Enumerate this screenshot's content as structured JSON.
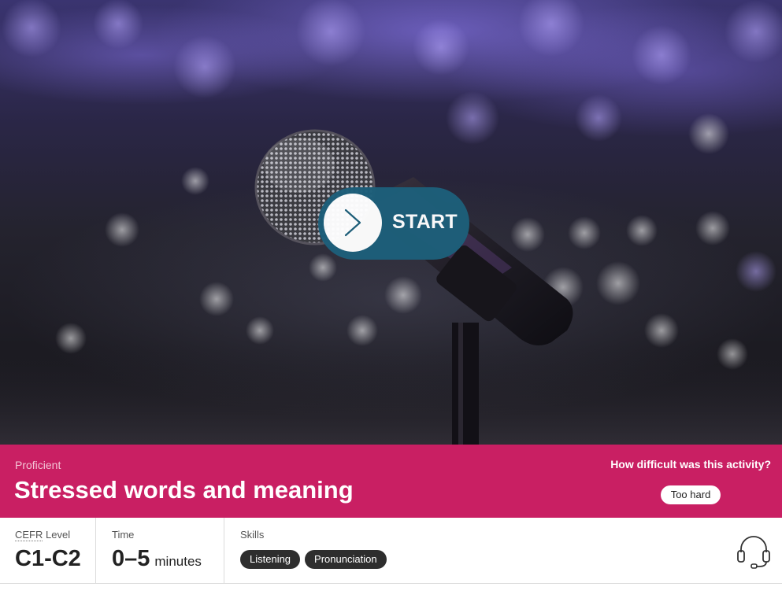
{
  "hero": {
    "start_label": "START",
    "icons": {
      "start": "chevron-right-icon",
      "microphone": "microphone-icon"
    }
  },
  "band": {
    "level": "Proficient",
    "title": "Stressed words and meaning",
    "difficulty_question": "How difficult was this activity?",
    "difficulty_choice": "Too hard",
    "color": "#c91f63"
  },
  "info": {
    "cefr": {
      "label_abbr": "CEFR",
      "label_rest": "Level",
      "value": "C1-C2"
    },
    "time": {
      "label": "Time",
      "value": "0–5",
      "unit": "minutes"
    },
    "skills": {
      "label": "Skills",
      "items": [
        "Listening",
        "Pronunciation"
      ]
    },
    "icons": {
      "audio": "headset-icon"
    }
  },
  "colors": {
    "start_button": "#1d5f7a",
    "pill": "#2e2e2e"
  }
}
